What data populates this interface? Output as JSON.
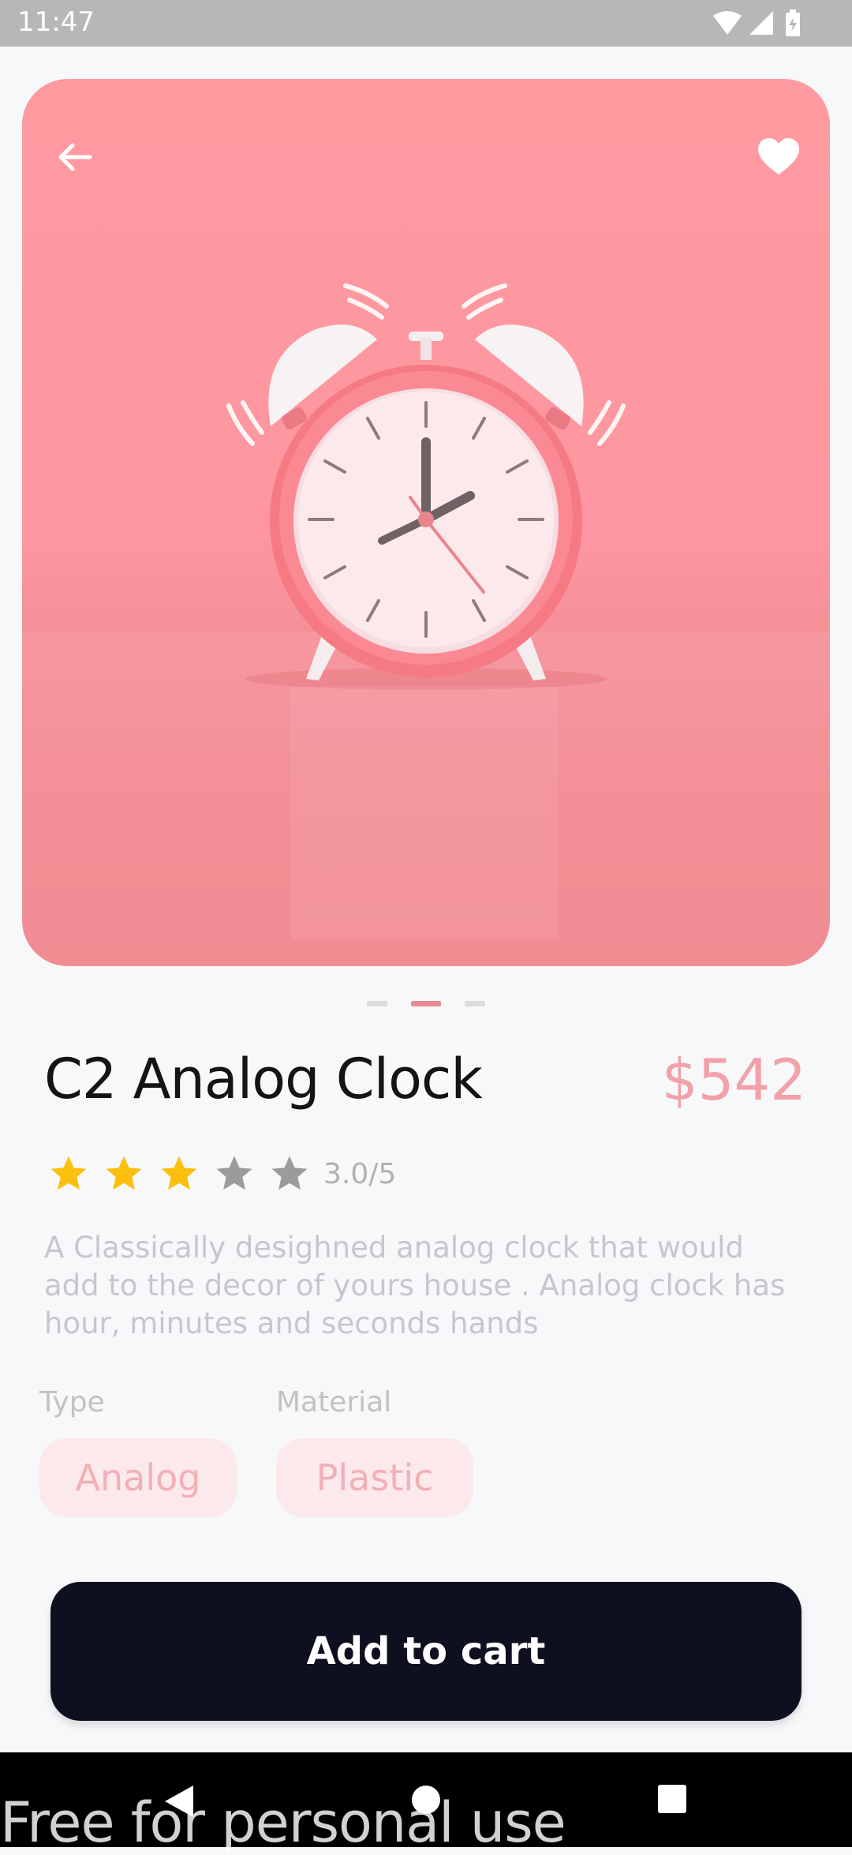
{
  "status_bar": {
    "time": "11:47"
  },
  "product": {
    "title": "C2 Analog Clock",
    "price": "$542",
    "rating": {
      "value": 3,
      "max": 5,
      "text": "3.0/5"
    },
    "description": "A Classically desighned analog clock that would add to the decor of yours house . Analog clock has hour, minutes and seconds hands",
    "attributes": [
      {
        "label": "Type",
        "value": "Analog"
      },
      {
        "label": "Material",
        "value": "Plastic"
      }
    ],
    "image_pager": {
      "count": 3,
      "active_index": 1
    }
  },
  "actions": {
    "add_to_cart": "Add to cart"
  },
  "icons": {
    "back": "arrow-left-icon",
    "favorite": "heart-icon",
    "star": "star-icon"
  },
  "colors": {
    "hero_background": "#fd98a0",
    "price": "#f2a1a8",
    "star_filled": "#fbbf0e",
    "star_empty": "#9b9b9b",
    "button": "#0e1020",
    "chip_background": "#fce9eb",
    "chip_text": "#f2b0b6"
  },
  "watermark": "Free for personal use"
}
